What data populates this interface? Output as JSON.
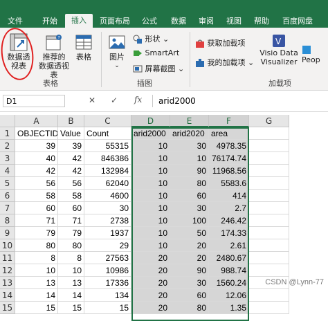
{
  "tabs": [
    {
      "label": "文件"
    },
    {
      "label": "开始"
    },
    {
      "label": "插入"
    },
    {
      "label": "页面布局"
    },
    {
      "label": "公式"
    },
    {
      "label": "数据"
    },
    {
      "label": "审阅"
    },
    {
      "label": "视图"
    },
    {
      "label": "帮助"
    },
    {
      "label": "百度网盘"
    }
  ],
  "ribbon": {
    "pivot_table": {
      "line1": "数据透",
      "line2": "视表"
    },
    "recommended_pivot": {
      "line1": "推荐的",
      "line2": "数据透视表"
    },
    "table": {
      "label": "表格"
    },
    "tables_group": "表格",
    "picture": {
      "label": "图片"
    },
    "shapes": "形状",
    "smartart": "SmartArt",
    "screenshot": "屏幕截图",
    "illustrations_group": "插图",
    "get_addins": "获取加载项",
    "my_addins": "我的加载项",
    "visio": {
      "line1": "Visio Data",
      "line2": "Visualizer"
    },
    "people": "Peop",
    "addins_group": "加载项"
  },
  "formula_bar": {
    "name_box": "D1",
    "cancel": "✕",
    "confirm": "✓",
    "fx": "fx",
    "formula": "arid2000"
  },
  "grid": {
    "columns": [
      "A",
      "B",
      "C",
      "D",
      "E",
      "F",
      "G"
    ],
    "rows": [
      {
        "n": "1",
        "cells": [
          "OBJECTID",
          "Value",
          "Count",
          "arid2000",
          "arid2020",
          "area",
          ""
        ]
      },
      {
        "n": "2",
        "cells": [
          "39",
          "39",
          "55315",
          "10",
          "30",
          "4978.35",
          ""
        ]
      },
      {
        "n": "3",
        "cells": [
          "40",
          "42",
          "846386",
          "10",
          "10",
          "76174.74",
          ""
        ]
      },
      {
        "n": "4",
        "cells": [
          "42",
          "42",
          "132984",
          "10",
          "90",
          "11968.56",
          ""
        ]
      },
      {
        "n": "5",
        "cells": [
          "56",
          "56",
          "62040",
          "10",
          "80",
          "5583.6",
          ""
        ]
      },
      {
        "n": "6",
        "cells": [
          "58",
          "58",
          "4600",
          "10",
          "60",
          "414",
          ""
        ]
      },
      {
        "n": "7",
        "cells": [
          "60",
          "60",
          "30",
          "10",
          "30",
          "2.7",
          ""
        ]
      },
      {
        "n": "8",
        "cells": [
          "71",
          "71",
          "2738",
          "10",
          "100",
          "246.42",
          ""
        ]
      },
      {
        "n": "9",
        "cells": [
          "79",
          "79",
          "1937",
          "10",
          "50",
          "174.33",
          ""
        ]
      },
      {
        "n": "10",
        "cells": [
          "80",
          "80",
          "29",
          "10",
          "20",
          "2.61",
          ""
        ]
      },
      {
        "n": "11",
        "cells": [
          "8",
          "8",
          "27563",
          "20",
          "20",
          "2480.67",
          ""
        ]
      },
      {
        "n": "12",
        "cells": [
          "10",
          "10",
          "10986",
          "20",
          "90",
          "988.74",
          ""
        ]
      },
      {
        "n": "13",
        "cells": [
          "13",
          "13",
          "17336",
          "20",
          "30",
          "1560.24",
          ""
        ]
      },
      {
        "n": "14",
        "cells": [
          "14",
          "14",
          "134",
          "20",
          "60",
          "12.06",
          ""
        ]
      },
      {
        "n": "15",
        "cells": [
          "15",
          "15",
          "15",
          "20",
          "80",
          "1.35",
          ""
        ]
      }
    ]
  },
  "watermark": "CSDN @Lynn-77",
  "colors": {
    "accent": "#217346",
    "annotation": "#e02020"
  }
}
